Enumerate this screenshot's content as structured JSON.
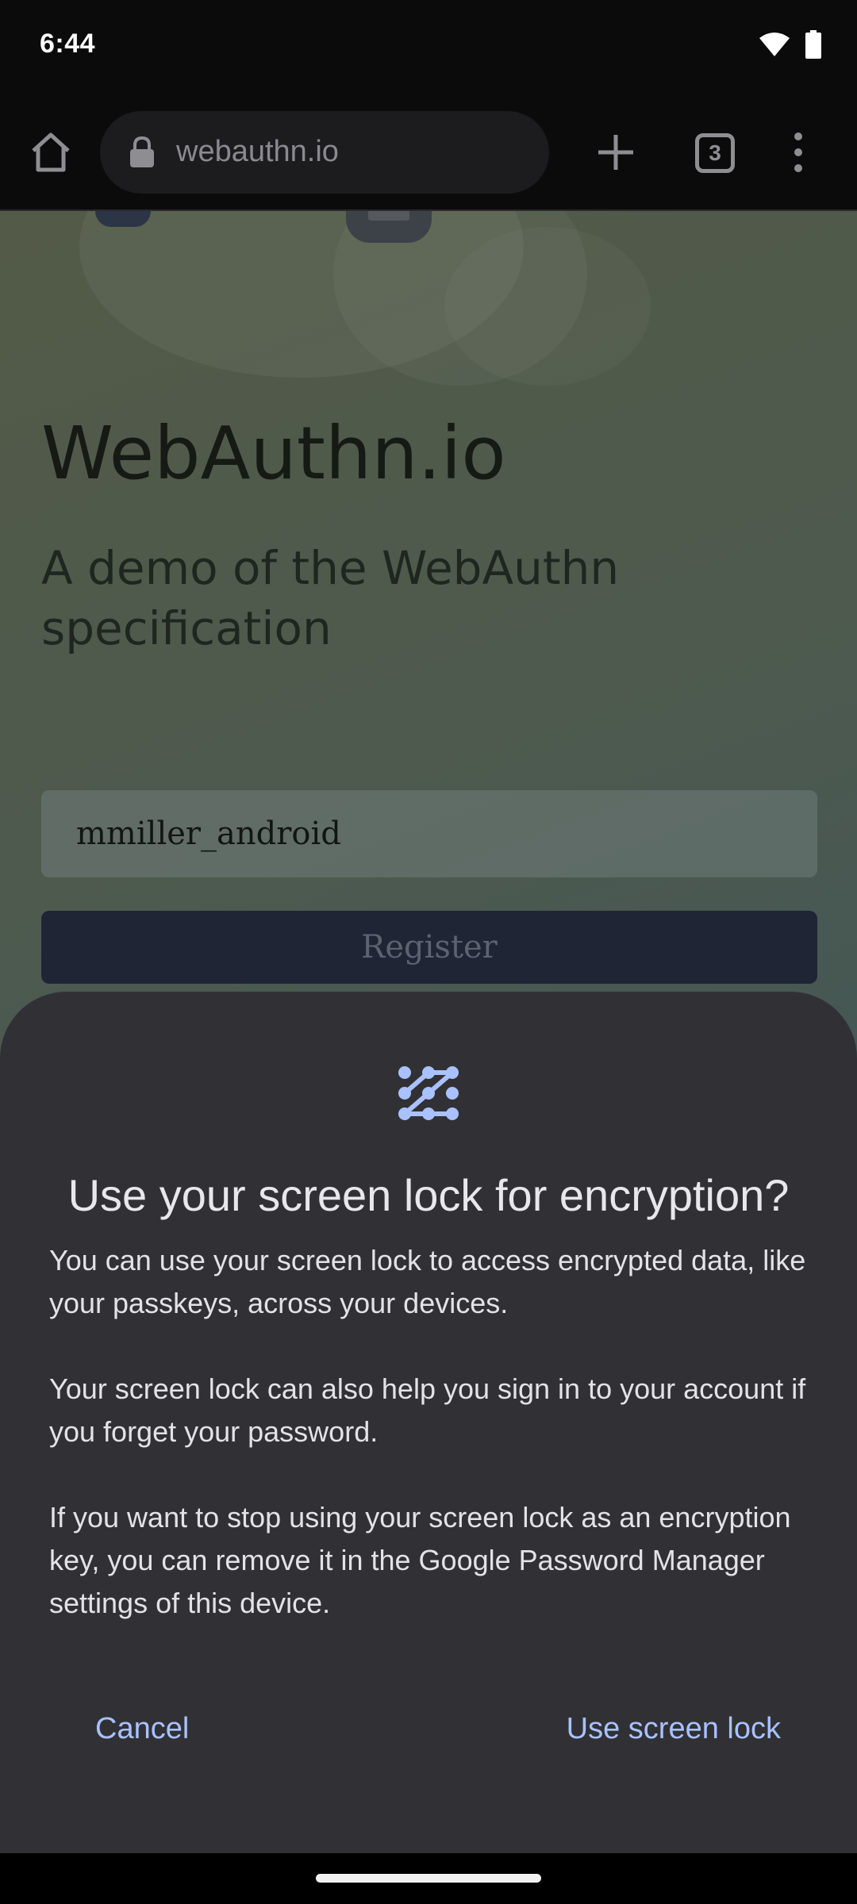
{
  "status_bar": {
    "time": "6:44",
    "icons": [
      "wifi-icon",
      "battery-icon"
    ]
  },
  "browser": {
    "url": "webauthn.io",
    "tab_count": "3",
    "icons": [
      "home-icon",
      "lock-icon",
      "plus-icon",
      "tabs-icon",
      "more-vert-icon"
    ]
  },
  "page": {
    "title": "WebAuthn.io",
    "subtitle": "A demo of the WebAuthn specification",
    "username_value": "mmiller_android",
    "register_label": "Register"
  },
  "dialog": {
    "icon": "pattern-lock-icon",
    "title": "Use your screen lock for encryption?",
    "paragraphs": [
      "You can use your screen lock to access encrypted data, like your passkeys, across your devices.",
      "Your screen lock can also help you sign in to your account if you forget your password.",
      "If you want to stop using your screen lock as an encryption key, you can remove it in the Google Password Manager settings of this device."
    ],
    "cancel_label": "Cancel",
    "confirm_label": "Use screen lock",
    "accent_color": "#a9c1ff",
    "background_color": "#313135"
  }
}
